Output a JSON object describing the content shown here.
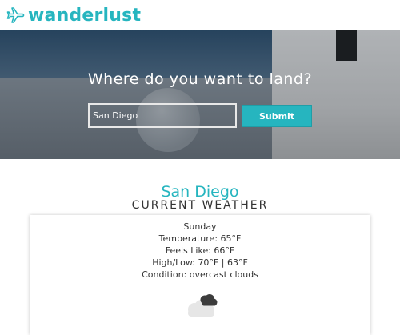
{
  "brand": {
    "name": "wanderlust",
    "color": "#26b5bf",
    "icon": "airplane-icon"
  },
  "hero": {
    "title": "Where do you want to land?",
    "search_value": "San Diego",
    "submit_label": "Submit"
  },
  "weather": {
    "city": "San Diego",
    "heading": "CURRENT WEATHER",
    "day": "Sunday",
    "temperature": "Temperature: 65°F",
    "feels_like": "Feels Like: 66°F",
    "high_low": "High/Low: 70°F | 63°F",
    "condition": "Condition: overcast clouds",
    "icon": "overcast-clouds-icon"
  }
}
